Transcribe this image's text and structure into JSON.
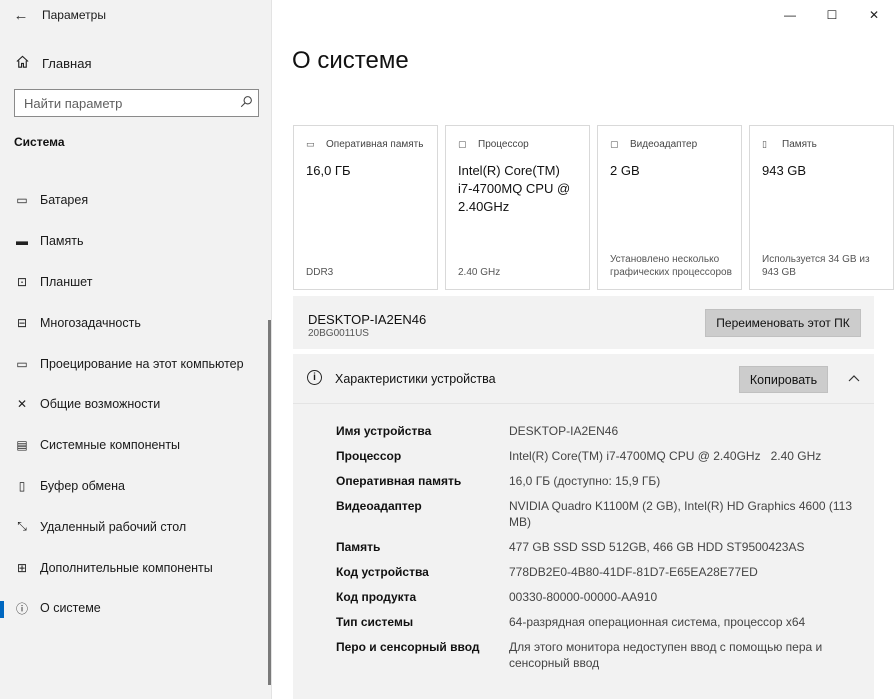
{
  "window": {
    "title": "Параметры",
    "back_glyph": "←",
    "minimize_glyph": "—",
    "maximize_glyph": "☐",
    "close_glyph": "✕"
  },
  "sidebar": {
    "home_label": "Главная",
    "search_placeholder": "Найти параметр",
    "section_title": "Система",
    "items": [
      {
        "label": "Батарея",
        "icon": "battery-icon",
        "glyph": "▭"
      },
      {
        "label": "Память",
        "icon": "storage-icon",
        "glyph": "▬"
      },
      {
        "label": "Планшет",
        "icon": "tablet-icon",
        "glyph": "⊡"
      },
      {
        "label": "Многозадачность",
        "icon": "multitasking-icon",
        "glyph": "⊟"
      },
      {
        "label": "Проецирование на этот компьютер",
        "icon": "projecting-icon",
        "glyph": "▭"
      },
      {
        "label": "Общие возможности",
        "icon": "shared-experiences-icon",
        "glyph": "✕"
      },
      {
        "label": "Системные компоненты",
        "icon": "system-components-icon",
        "glyph": "▤"
      },
      {
        "label": "Буфер обмена",
        "icon": "clipboard-icon",
        "glyph": "▯"
      },
      {
        "label": "Удаленный рабочий стол",
        "icon": "remote-desktop-icon",
        "glyph": "⤡"
      },
      {
        "label": "Дополнительные компоненты",
        "icon": "optional-features-icon",
        "glyph": "⊞"
      },
      {
        "label": "О системе",
        "icon": "about-icon",
        "glyph": "ⓘ",
        "active": true
      }
    ]
  },
  "main": {
    "page_title": "О системе",
    "cards": [
      {
        "label": "Оперативная память",
        "icon": "ram-icon",
        "value": "16,0 ГБ",
        "foot": "DDR3"
      },
      {
        "label": "Процессор",
        "icon": "cpu-icon",
        "value": "Intel(R) Core(TM) i7-4700MQ CPU @ 2.40GHz",
        "foot": "2.40 GHz"
      },
      {
        "label": "Видеоадаптер",
        "icon": "gpu-icon",
        "value": "2 GB",
        "foot": "Установлено несколько графических процессоров"
      },
      {
        "label": "Память",
        "icon": "disk-icon",
        "value": "943 GB",
        "foot": "Используется 34 GB из 943 GB"
      }
    ],
    "device": {
      "name": "DESKTOP-IA2EN46",
      "model": "20BG0011US",
      "rename_label": "Переименовать этот ПК"
    },
    "specs": {
      "title": "Характеристики устройства",
      "copy_label": "Копировать",
      "rows": [
        {
          "key": "Имя устройства",
          "value": "DESKTOP-IA2EN46"
        },
        {
          "key": "Процессор",
          "value": "Intel(R) Core(TM) i7-4700MQ CPU @ 2.40GHz   2.40 GHz"
        },
        {
          "key": "Оперативная память",
          "value": "16,0 ГБ (доступно: 15,9 ГБ)"
        },
        {
          "key": "Видеоадаптер",
          "value": "NVIDIA Quadro K1100M (2 GB), Intel(R) HD Graphics 4600 (113 MB)"
        },
        {
          "key": "Память",
          "value": "477 GB SSD SSD 512GB, 466 GB HDD ST9500423AS"
        },
        {
          "key": "Код устройства",
          "value": "778DB2E0-4B80-41DF-81D7-E65EA28E77ED"
        },
        {
          "key": "Код продукта",
          "value": "00330-80000-00000-AA910"
        },
        {
          "key": "Тип системы",
          "value": "64-разрядная операционная система, процессор x64"
        },
        {
          "key": "Перо и сенсорный ввод",
          "value": "Для этого монитора недоступен ввод с помощью пера и сенсорный ввод"
        }
      ]
    }
  },
  "colors": {
    "accent": "#0067c0",
    "sidebar_bg": "#f2f2f2",
    "button_bg": "#cccccc"
  }
}
